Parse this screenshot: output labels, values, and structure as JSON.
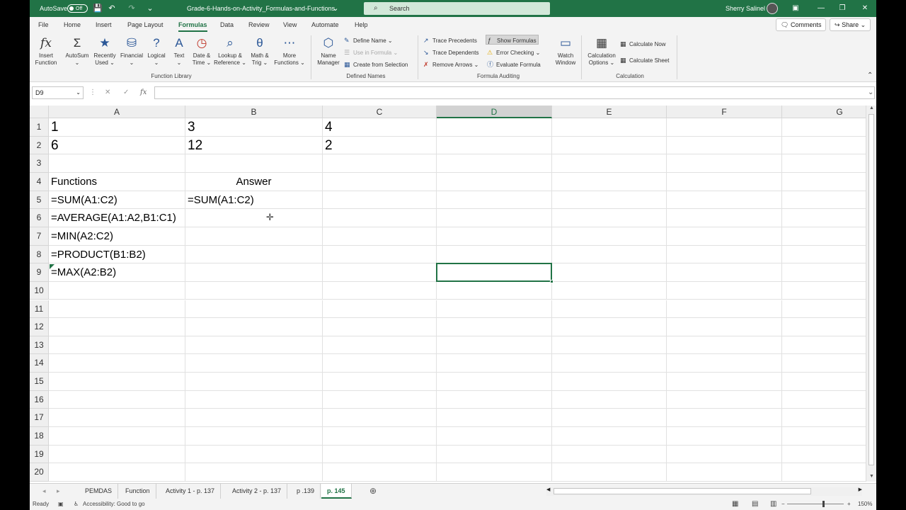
{
  "titlebar": {
    "autosave_label": "AutoSave",
    "autosave_state": "Off",
    "filename": "Grade-6-Hands-on-Activity_Formulas-and-Functions",
    "search_placeholder": "Search",
    "user_name": "Sherry Salinel",
    "save_icon": "💾",
    "undo_icon": "↶",
    "redo_icon": "↷",
    "qat_icon": "⌄",
    "ribbon_display_icon": "▣",
    "minimize_icon": "—",
    "restore_icon": "❐",
    "close_icon": "✕",
    "accent": "#217346"
  },
  "tabs": [
    "File",
    "Home",
    "Insert",
    "Page Layout",
    "Formulas",
    "Data",
    "Review",
    "View",
    "Automate",
    "Help"
  ],
  "active_tab": "Formulas",
  "comments_label": "Comments",
  "share_label": "Share",
  "ribbon": {
    "insert_function": {
      "line1": "Insert",
      "line2": "Function",
      "icon": "fx"
    },
    "autosum": {
      "line1": "AutoSum",
      "line2": "⌄",
      "icon": "Σ"
    },
    "recently_used": {
      "line1": "Recently",
      "line2": "Used ⌄",
      "icon": "★"
    },
    "financial": {
      "line1": "Financial",
      "line2": "⌄",
      "icon": "⛁"
    },
    "logical": {
      "line1": "Logical",
      "line2": "⌄",
      "icon": "?"
    },
    "text": {
      "line1": "Text",
      "line2": "⌄",
      "icon": "A"
    },
    "date_time": {
      "line1": "Date &",
      "line2": "Time ⌄",
      "icon": "◷"
    },
    "lookup_reference": {
      "line1": "Lookup &",
      "line2": "Reference ⌄",
      "icon": "⌕"
    },
    "math_trig": {
      "line1": "Math &",
      "line2": "Trig ⌄",
      "icon": "θ"
    },
    "more_functions": {
      "line1": "More",
      "line2": "Functions ⌄",
      "icon": "⋯"
    },
    "function_library_label": "Function Library",
    "name_manager": {
      "line1": "Name",
      "line2": "Manager",
      "icon": "⬡"
    },
    "define_name": "Define Name ⌄",
    "use_in_formula": "Use in Formula ⌄",
    "create_from_selection": "Create from Selection",
    "defined_names_label": "Defined Names",
    "trace_precedents": "Trace Precedents",
    "trace_dependents": "Trace Dependents",
    "remove_arrows": "Remove Arrows ⌄",
    "show_formulas": "Show Formulas",
    "error_checking": "Error Checking ⌄",
    "evaluate_formula": "Evaluate Formula",
    "formula_auditing_label": "Formula Auditing",
    "watch_window": {
      "line1": "Watch",
      "line2": "Window",
      "icon": "▭"
    },
    "calculation_options": {
      "line1": "Calculation",
      "line2": "Options ⌄",
      "icon": "▦"
    },
    "calculate_now": "Calculate Now",
    "calculate_sheet": "Calculate Sheet",
    "calculation_label": "Calculation",
    "collapse_icon": "⌃"
  },
  "formula_bar": {
    "name_box": "D9",
    "name_box_arrow": "⌄",
    "dots": "⋮",
    "cancel_icon": "✕",
    "enter_icon": "✓",
    "fx_label": "fx",
    "value": "",
    "expand_icon": "⌄"
  },
  "grid": {
    "columns": [
      "A",
      "B",
      "C",
      "D",
      "E",
      "F",
      "G"
    ],
    "selected_column": "D",
    "rows": [
      "1",
      "2",
      "3",
      "4",
      "5",
      "6",
      "7",
      "8",
      "9",
      "10",
      "11",
      "12",
      "13",
      "14",
      "15",
      "16",
      "17",
      "18",
      "19",
      "20"
    ],
    "cells": {
      "A1": "1",
      "B1": "3",
      "C1": "4",
      "A2": "6",
      "B2": "12",
      "C2": "2",
      "A4": "Functions",
      "B4": "Answer",
      "A5": "=SUM(A1:C2)",
      "B5": "=SUM(A1:C2)",
      "A6": "=AVERAGE(A1:A2,B1:C1)",
      "A7": "=MIN(A2:C2)",
      "A8": "=PRODUCT(B1:B2)",
      "A9": "=MAX(A2:B2)"
    },
    "selected_cell": "D9",
    "cursor_icon": "✛"
  },
  "sheet_tabs": [
    "PEMDAS",
    "Function",
    "Activity 1 - p. 137",
    "Activity 2 - p. 137",
    "p .139",
    "p. 145"
  ],
  "active_sheet": "p. 145",
  "sheet_nav_prev": "◂",
  "sheet_nav_next": "▸",
  "add_sheet_icon": "⊕",
  "status": {
    "ready": "Ready",
    "accessibility": "Accessibility: Good to go",
    "accessibility_icon": "♿",
    "view_normal_icon": "▦",
    "view_layout_icon": "▤",
    "view_break_icon": "▥",
    "zoom_out": "−",
    "zoom_in": "+",
    "zoom": "150%",
    "zoom_fraction": 0.62
  }
}
